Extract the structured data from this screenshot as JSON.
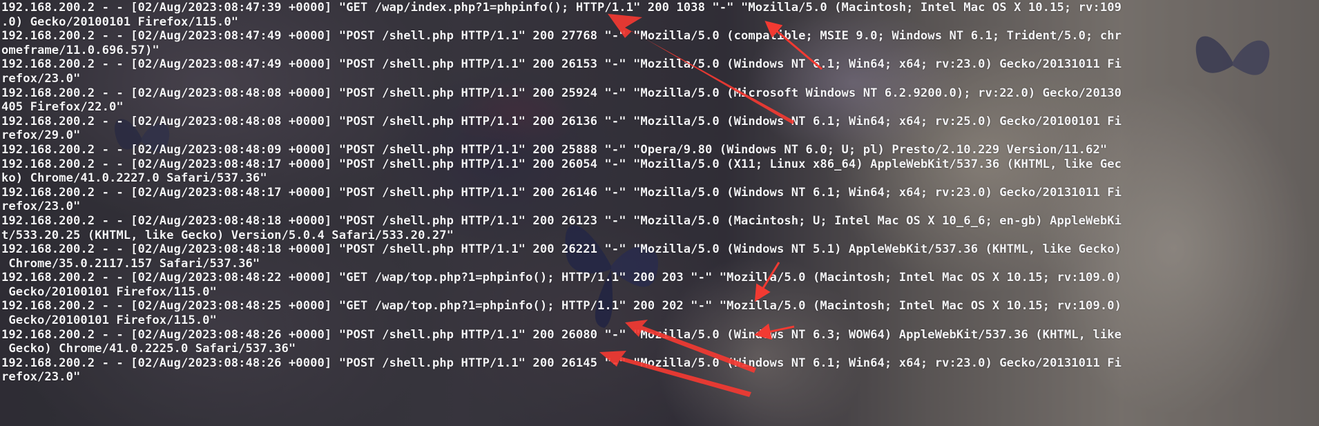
{
  "terminal": {
    "lines": [
      "192.168.200.2 - - [02/Aug/2023:08:47:39 +0000] \"GET /wap/index.php?1=phpinfo(); HTTP/1.1\" 200 1038 \"-\" \"Mozilla/5.0 (Macintosh; Intel Mac OS X 10.15; rv:109",
      ".0) Gecko/20100101 Firefox/115.0\"",
      "192.168.200.2 - - [02/Aug/2023:08:47:49 +0000] \"POST /shell.php HTTP/1.1\" 200 27768 \"-\" \"Mozilla/5.0 (compatible; MSIE 9.0; Windows NT 6.1; Trident/5.0; chr",
      "omeframe/11.0.696.57)\"",
      "192.168.200.2 - - [02/Aug/2023:08:47:49 +0000] \"POST /shell.php HTTP/1.1\" 200 26153 \"-\" \"Mozilla/5.0 (Windows NT 6.1; Win64; x64; rv:23.0) Gecko/20131011 Fi",
      "refox/23.0\"",
      "192.168.200.2 - - [02/Aug/2023:08:48:08 +0000] \"POST /shell.php HTTP/1.1\" 200 25924 \"-\" \"Mozilla/5.0 (Microsoft Windows NT 6.2.9200.0); rv:22.0) Gecko/20130",
      "405 Firefox/22.0\"",
      "192.168.200.2 - - [02/Aug/2023:08:48:08 +0000] \"POST /shell.php HTTP/1.1\" 200 26136 \"-\" \"Mozilla/5.0 (Windows NT 6.1; Win64; x64; rv:25.0) Gecko/20100101 Fi",
      "refox/29.0\"",
      "192.168.200.2 - - [02/Aug/2023:08:48:09 +0000] \"POST /shell.php HTTP/1.1\" 200 25888 \"-\" \"Opera/9.80 (Windows NT 6.0; U; pl) Presto/2.10.229 Version/11.62\"",
      "192.168.200.2 - - [02/Aug/2023:08:48:17 +0000] \"POST /shell.php HTTP/1.1\" 200 26054 \"-\" \"Mozilla/5.0 (X11; Linux x86_64) AppleWebKit/537.36 (KHTML, like Gec",
      "ko) Chrome/41.0.2227.0 Safari/537.36\"",
      "192.168.200.2 - - [02/Aug/2023:08:48:17 +0000] \"POST /shell.php HTTP/1.1\" 200 26146 \"-\" \"Mozilla/5.0 (Windows NT 6.1; Win64; x64; rv:23.0) Gecko/20131011 Fi",
      "refox/23.0\"",
      "192.168.200.2 - - [02/Aug/2023:08:48:18 +0000] \"POST /shell.php HTTP/1.1\" 200 26123 \"-\" \"Mozilla/5.0 (Macintosh; U; Intel Mac OS X 10_6_6; en-gb) AppleWebKi",
      "t/533.20.25 (KHTML, like Gecko) Version/5.0.4 Safari/533.20.27\"",
      "192.168.200.2 - - [02/Aug/2023:08:48:18 +0000] \"POST /shell.php HTTP/1.1\" 200 26221 \"-\" \"Mozilla/5.0 (Windows NT 5.1) AppleWebKit/537.36 (KHTML, like Gecko)",
      " Chrome/35.0.2117.157 Safari/537.36\"",
      "192.168.200.2 - - [02/Aug/2023:08:48:22 +0000] \"GET /wap/top.php?1=phpinfo(); HTTP/1.1\" 200 203 \"-\" \"Mozilla/5.0 (Macintosh; Intel Mac OS X 10.15; rv:109.0)",
      " Gecko/20100101 Firefox/115.0\"",
      "192.168.200.2 - - [02/Aug/2023:08:48:25 +0000] \"GET /wap/top.php?1=phpinfo(); HTTP/1.1\" 200 202 \"-\" \"Mozilla/5.0 (Macintosh; Intel Mac OS X 10.15; rv:109.0)",
      " Gecko/20100101 Firefox/115.0\"",
      "192.168.200.2 - - [02/Aug/2023:08:48:26 +0000] \"POST /shell.php HTTP/1.1\" 200 26080 \"-\" \"Mozilla/5.0 (Windows NT 6.3; WOW64) AppleWebKit/537.36 (KHTML, like",
      " Gecko) Chrome/41.0.2225.0 Safari/537.36\"",
      "192.168.200.2 - - [02/Aug/2023:08:48:26 +0000] \"POST /shell.php HTTP/1.1\" 200 26145 \"-\" \"Mozilla/5.0 (Windows NT 6.1; Win64; x64; rv:23.0) Gecko/20131011 Fi",
      "refox/23.0\""
    ]
  },
  "annotations": {
    "arrow_color": "#f23a32"
  },
  "theme": {
    "text_color": "#f3f3f5",
    "terminal_overlay": "rgba(20,20,26,0.35)"
  }
}
